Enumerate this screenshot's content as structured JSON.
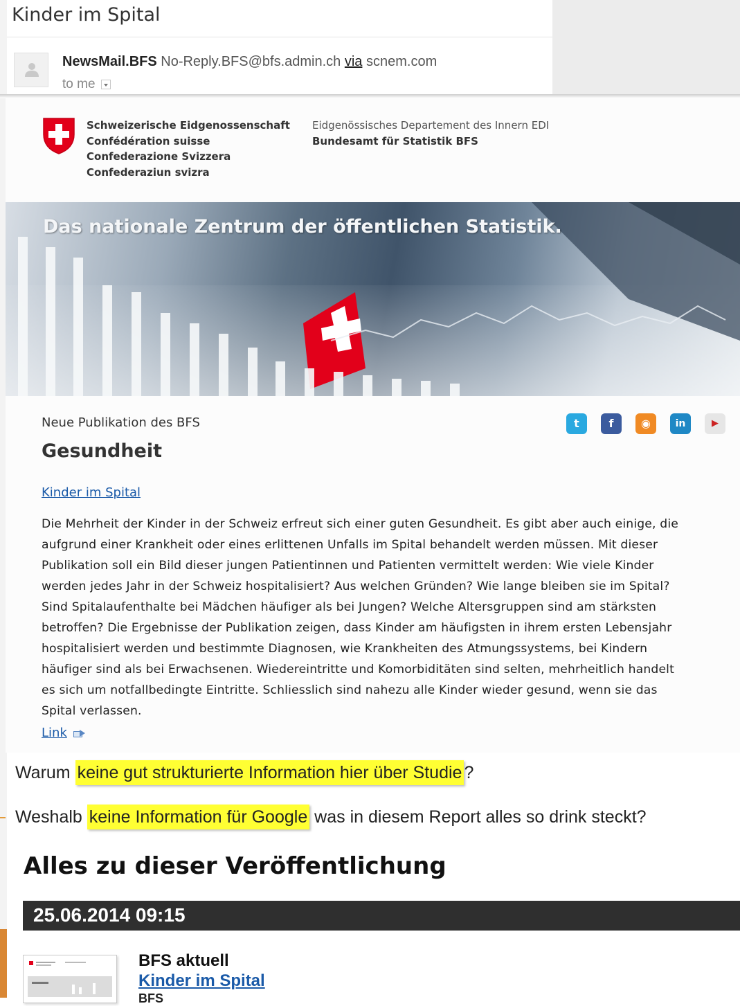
{
  "email": {
    "subject": "Kinder im Spital",
    "sender_name": "NewsMail.BFS",
    "sender_address": "No-Reply.BFS@bfs.admin.ch",
    "via_label": "via",
    "via_domain": "scnem.com",
    "recipient": "to me"
  },
  "newsletter": {
    "confederation_lines": [
      "Schweizerische Eidgenossenschaft",
      "Confédération suisse",
      "Confederazione Svizzera",
      "Confederaziun svizra"
    ],
    "department": "Eidgenössisches Departement des Innern EDI",
    "office": "Bundesamt für Statistik BFS",
    "banner_title": "Das nationale Zentrum der öffentlichen Statistik.",
    "pub_label": "Neue Publikation des BFS",
    "pub_title": "Gesundheit",
    "pub_link": "Kinder im Spital",
    "pub_text": "Die Mehrheit der Kinder in der Schweiz erfreut sich einer guten Gesundheit. Es gibt aber auch einige, die aufgrund einer Krankheit oder eines erlittenen Unfalls im Spital behandelt werden müssen. Mit dieser Publikation soll ein Bild dieser jungen Patientinnen und Patienten vermittelt werden: Wie viele Kinder werden jedes Jahr in der Schweiz hospitalisiert? Aus welchen Gründen? Wie lange bleiben sie im Spital? Sind Spitalaufenthalte bei Mädchen häufiger als bei Jungen? Welche Altersgruppen sind am stärksten betroffen? Die Ergebnisse der Publikation zeigen, dass Kinder am häufigsten in ihrem ersten Lebensjahr hospitalisiert werden und bestimmte Diagnosen, wie Krankheiten des Atmungssystems, bei Kindern häufiger sind als bei Erwachsenen. Wiedereintritte und Komorbiditäten sind selten, mehrheitlich handelt es sich um notfallbedingte Eintritte. Schliesslich sind nahezu alle Kinder wieder gesund, wenn sie das Spital verlassen.",
    "more_link": "Link",
    "social": [
      {
        "name": "twitter-icon",
        "glyph": "t",
        "color": "#2aa9e0"
      },
      {
        "name": "facebook-icon",
        "glyph": "f",
        "color": "#3b5b9e"
      },
      {
        "name": "rss-icon",
        "glyph": "◉",
        "color": "#f08a24"
      },
      {
        "name": "linkedin-icon",
        "glyph": "in",
        "color": "#1f88c5"
      },
      {
        "name": "youtube-icon",
        "glyph": "▶",
        "color": "#e6e6e6"
      }
    ]
  },
  "comments": {
    "q1_before": "Warum ",
    "q1_highlight": "keine gut strukturierte Information hier über Studie",
    "q1_after": "?",
    "q2_before": "Weshalb ",
    "q2_highlight": "keine Information für Google",
    "q2_after": " was in diesem Report alles so drink steckt?"
  },
  "release": {
    "section_title": "Alles zu dieser Veröffentlichung",
    "datetime": "25.06.2014 09:15",
    "series": "BFS aktuell",
    "link": "Kinder im Spital",
    "cut_text": "BFS"
  },
  "colors": {
    "link": "#1a5aa8",
    "highlight": "#ffff33",
    "swiss_red": "#e2001a"
  }
}
